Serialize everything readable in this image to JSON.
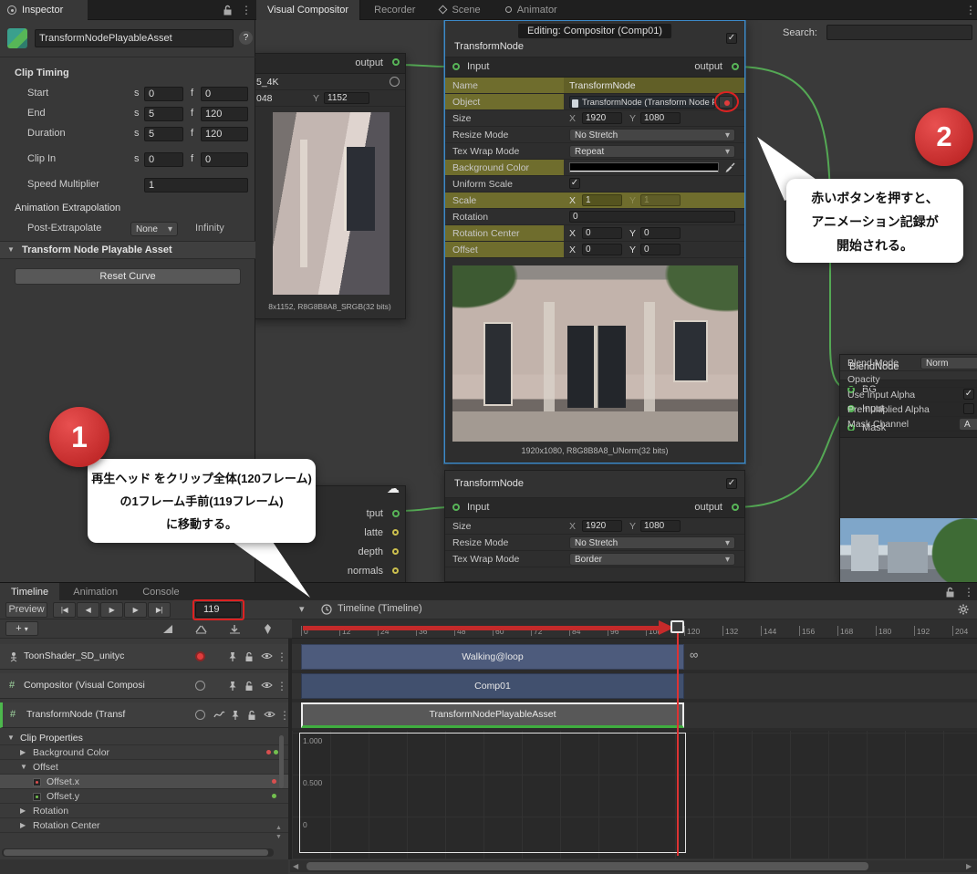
{
  "colors": {
    "annotation_red": "#cf2f2f",
    "selection_blue": "#3c8ac8",
    "edge_green": "#58b558",
    "record_red": "#e03c3c",
    "highlight_olive": "#6f6d2d",
    "clip_blue": "#4d5b7c",
    "clip_dark_blue": "#41506e",
    "clip_gray": "#585858",
    "clip_green_edge": "#3fae3f"
  },
  "icons": {
    "caret_down": "▾",
    "check": "✓",
    "menu_dots": "⋮",
    "cloud": "☁",
    "infinity": "∞",
    "plus": "+",
    "help": "?",
    "foldout_open": "▼",
    "foldout_closed": "▶",
    "scroll_left": "◀",
    "scroll_right": "▶",
    "scroll_up": "▲",
    "scroll_down": "▼",
    "hash": "#",
    "transport": [
      "|◀",
      "◀",
      "▶",
      "▶",
      "▶|"
    ]
  },
  "xy": {
    "x": "X",
    "y": "Y"
  },
  "top": {
    "inspector_tab": "Inspector",
    "window_tabs": [
      "Visual Compositor",
      "Recorder",
      "Scene",
      "Animator"
    ]
  },
  "inspector": {
    "asset_name": "TransformNodePlayableAsset",
    "clip_timing": {
      "title": "Clip Timing",
      "s_unit": "s",
      "f_unit": "f",
      "rows": [
        {
          "label": "Start",
          "s": "0",
          "f": "0"
        },
        {
          "label": "End",
          "s": "5",
          "f": "120"
        },
        {
          "label": "Duration",
          "s": "5",
          "f": "120"
        },
        {
          "label": "Clip In",
          "s": "0",
          "f": "0"
        }
      ],
      "speed_label": "Speed Multiplier",
      "speed_value": "1"
    },
    "extrapolation": {
      "title": "Animation Extrapolation",
      "post_label": "Post-Extrapolate",
      "post_value": "None",
      "infinity_label": "Infinity"
    },
    "foldout_title": "Transform Node Playable Asset",
    "reset_button": "Reset Curve"
  },
  "compositor": {
    "editing_label": "Editing: Compositor (Comp01)",
    "search_label": "Search:",
    "left_node": {
      "output_port": "output",
      "name_partial": "5_4K",
      "size_x_partial": "048",
      "size_y": "1152",
      "caption": "8x1152, R8G8B8A8_SRGB(32 bits)"
    },
    "main_node": {
      "title": "TransformNode",
      "input_port": "Input",
      "output_port": "output",
      "rows": {
        "name_label": "Name",
        "name_value": "TransformNode",
        "object_label": "Object",
        "object_value": "TransformNode (Transform Node P",
        "size_label": "Size",
        "size_x": "1920",
        "size_y": "1080",
        "resize_label": "Resize Mode",
        "resize_value": "No Stretch",
        "wrap_label": "Tex Wrap Mode",
        "wrap_value": "Repeat",
        "bg_label": "Background Color",
        "uniform_label": "Uniform Scale",
        "scale_label": "Scale",
        "scale_x": "1",
        "scale_y": "1",
        "rotation_label": "Rotation",
        "rotation_value": "0",
        "rot_center_label": "Rotation Center",
        "rot_center_x": "0",
        "rot_center_y": "0",
        "offset_label": "Offset",
        "offset_x": "0",
        "offset_y": "0"
      },
      "preview_caption": "1920x1080, R8G8B8A8_UNorm(32 bits)"
    },
    "hidden_ports": [
      "tput",
      "latte",
      "depth",
      "normals"
    ],
    "node2": {
      "title": "TransformNode",
      "input_port": "Input",
      "output_port": "output",
      "size_label": "Size",
      "size_x": "1920",
      "size_y": "1080",
      "resize_label": "Resize Mode",
      "resize_value": "No Stretch",
      "wrap_label": "Tex Wrap Mode",
      "wrap_value": "Border"
    },
    "blend_node": {
      "title": "BlendNode",
      "port_bg": "BG",
      "port_input": "Input",
      "port_mask": "Mask",
      "blend_mode_label": "Blend Mode",
      "blend_mode_value": "Norm",
      "opacity_label": "Opacity",
      "use_input_alpha_label": "Use Input Alpha",
      "premultiplied_label": "Premultiplied Alpha",
      "mask_channel_label": "Mask Channel",
      "mask_channel_value": "A"
    }
  },
  "callouts": {
    "c1": {
      "badge": "1",
      "line1": "再生ヘッド をクリップ全体(120フレーム)",
      "line2": "の1フレーム手前(119フレーム)",
      "line3": "に移動する。"
    },
    "c2": {
      "badge": "2",
      "line1": "赤いボタンを押すと、",
      "line2": "アニメーション記録が",
      "line3": "開始される。"
    }
  },
  "timeline": {
    "tabs": [
      "Timeline",
      "Animation",
      "Console"
    ],
    "preview_label": "Preview",
    "frame_value": "119",
    "breadcrumb": "Timeline (Timeline)",
    "ruler_ticks": [
      "0",
      "12",
      "24",
      "36",
      "48",
      "60",
      "72",
      "84",
      "96",
      "108",
      "120",
      "132",
      "144",
      "156",
      "168",
      "180",
      "192",
      "204"
    ],
    "tracks": [
      {
        "name": "ToonShader_SD_unityc",
        "clip": "Walking@loop",
        "hold": "∞"
      },
      {
        "name": "Compositor (Visual Composi",
        "clip": "Comp01"
      },
      {
        "name": "TransformNode (Transf",
        "clip": "TransformNodePlayableAsset"
      }
    ],
    "properties": {
      "header": "Clip Properties",
      "rows": [
        {
          "label": "Background Color"
        },
        {
          "label": "Offset"
        },
        {
          "label": "Offset.x"
        },
        {
          "label": "Offset.y"
        },
        {
          "label": "Rotation"
        },
        {
          "label": "Rotation Center"
        }
      ]
    },
    "curve_labels": [
      "1.000",
      "0.500",
      "0"
    ]
  }
}
